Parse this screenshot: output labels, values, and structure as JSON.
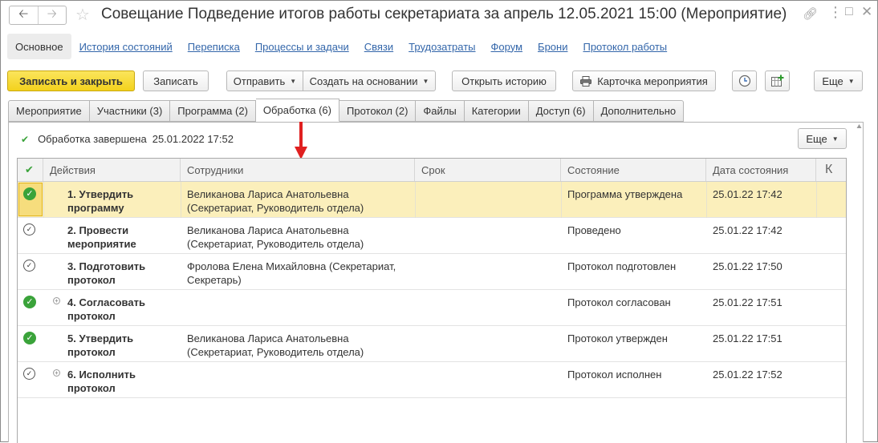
{
  "window": {
    "title": "Совещание Подведение итогов работы секретариата за апрель 12.05.2021 15:00 (Мероприятие)"
  },
  "nav_links": {
    "active": "Основное",
    "items": [
      "История состояний",
      "Переписка",
      "Процессы и задачи",
      "Связи",
      "Трудозатраты",
      "Форум",
      "Брони",
      "Протокол работы"
    ]
  },
  "toolbar": {
    "save_close": "Записать и закрыть",
    "save": "Записать",
    "send": "Отправить",
    "create_based": "Создать на основании",
    "open_history": "Открыть историю",
    "event_card": "Карточка мероприятия",
    "more": "Еще"
  },
  "tabs": [
    "Мероприятие",
    "Участники (3)",
    "Программа (2)",
    "Обработка (6)",
    "Протокол (2)",
    "Файлы",
    "Категории",
    "Доступ (6)",
    "Дополнительно"
  ],
  "active_tab_index": 3,
  "processing": {
    "status_text": "Обработка завершена",
    "status_date": "25.01.2022 17:52",
    "more": "Еще"
  },
  "table": {
    "columns": {
      "actions": "Действия",
      "employees": "Сотрудники",
      "deadline": "Срок",
      "state": "Состояние",
      "state_date": "Дата состояния",
      "k": "К"
    },
    "rows": [
      {
        "icon": "green-check-icon",
        "expandable": false,
        "selected": true,
        "action_1": "1. Утвердить",
        "action_2": "программу",
        "emp_1": "Великанова Лариса Анатольевна",
        "emp_2": "(Секретариат, Руководитель отдела)",
        "deadline": "",
        "state": "Программа утверждена",
        "date": "25.01.22 17:42"
      },
      {
        "icon": "done-circle-icon",
        "expandable": false,
        "selected": false,
        "action_1": "2. Провести",
        "action_2": "мероприятие",
        "emp_1": "Великанова Лариса Анатольевна",
        "emp_2": "(Секретариат, Руководитель отдела)",
        "deadline": "",
        "state": "Проведено",
        "date": "25.01.22 17:42"
      },
      {
        "icon": "done-circle-icon",
        "expandable": false,
        "selected": false,
        "action_1": "3. Подготовить",
        "action_2": "протокол",
        "emp_1": "Фролова Елена Михайловна (Секретариат,",
        "emp_2": "Секретарь)",
        "deadline": "",
        "state": "Протокол подготовлен",
        "date": "25.01.22 17:50"
      },
      {
        "icon": "green-check-icon",
        "expandable": true,
        "selected": false,
        "action_1": "4. Согласовать",
        "action_2": "протокол",
        "emp_1": "",
        "emp_2": "",
        "deadline": "",
        "state": "Протокол согласован",
        "date": "25.01.22 17:51"
      },
      {
        "icon": "green-check-icon",
        "expandable": false,
        "selected": false,
        "action_1": "5. Утвердить",
        "action_2": "протокол",
        "emp_1": "Великанова Лариса Анатольевна",
        "emp_2": "(Секретариат, Руководитель отдела)",
        "deadline": "",
        "state": "Протокол утвержден",
        "date": "25.01.22 17:51"
      },
      {
        "icon": "done-circle-icon",
        "expandable": true,
        "selected": false,
        "action_1": "6. Исполнить",
        "action_2": "протокол",
        "emp_1": "",
        "emp_2": "",
        "deadline": "",
        "state": "Протокол исполнен",
        "date": "25.01.22 17:52"
      }
    ]
  },
  "colors": {
    "accent_yellow": "#f3d21c",
    "selected_row": "#fbefbb",
    "link": "#3366aa",
    "check_green": "#3aa33a",
    "annotation_arrow": "#e02020"
  }
}
